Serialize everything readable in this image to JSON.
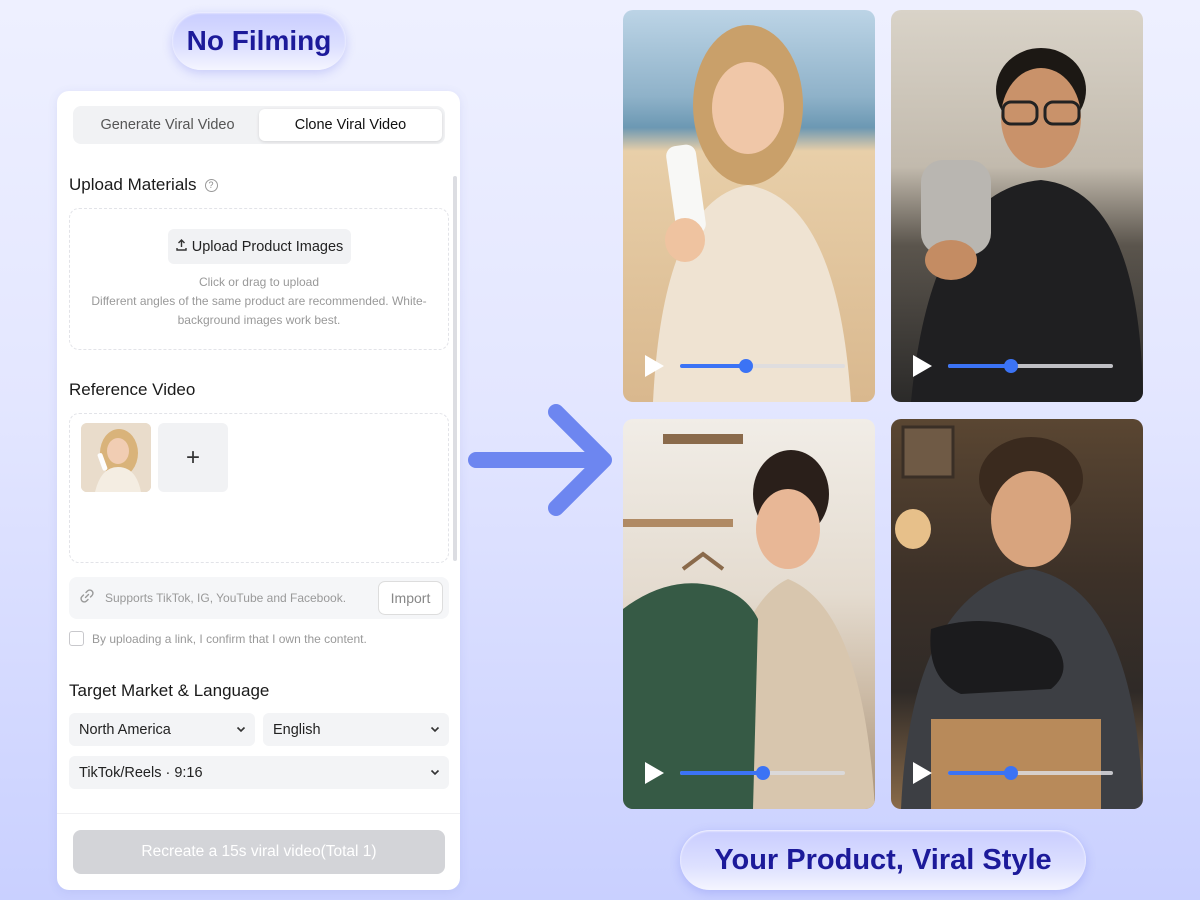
{
  "badges": {
    "top": "No Filming",
    "bottom": "Your Product, Viral Style"
  },
  "tabs": [
    {
      "label": "Generate Viral Video",
      "active": false
    },
    {
      "label": "Clone Viral Video",
      "active": true
    }
  ],
  "upload": {
    "title": "Upload Materials",
    "help_icon": "?",
    "button_label": "Upload Product Images",
    "button_icon": "upload-icon",
    "hint": "Click or drag to upload",
    "note": "Different angles of the same product are recommended. White-background images work best."
  },
  "reference": {
    "title": "Reference Video",
    "add_label": "+",
    "link_placeholder": "Supports TikTok, IG, YouTube and Facebook.",
    "import_label": "Import",
    "consent_text": "By uploading a link, I confirm that I own the content.",
    "consent_checked": false
  },
  "market": {
    "title": "Target Market & Language",
    "region": "North America",
    "language": "English",
    "format": "TikTok/Reels · 9:16"
  },
  "cta_label": "Recreate a 15s viral video(Total 1)",
  "videos": [
    {
      "name": "video-beach-woman-lotion",
      "progress": 0.4
    },
    {
      "name": "video-man-speaker",
      "progress": 0.38
    },
    {
      "name": "video-woman-sweater",
      "progress": 0.5
    },
    {
      "name": "video-man-shoe",
      "progress": 0.38
    }
  ],
  "colors": {
    "accent": "#3b73f5",
    "badge_text": "#1c1a9a",
    "arrow": "#6d86f0",
    "cta_disabled": "#d3d4d8"
  }
}
